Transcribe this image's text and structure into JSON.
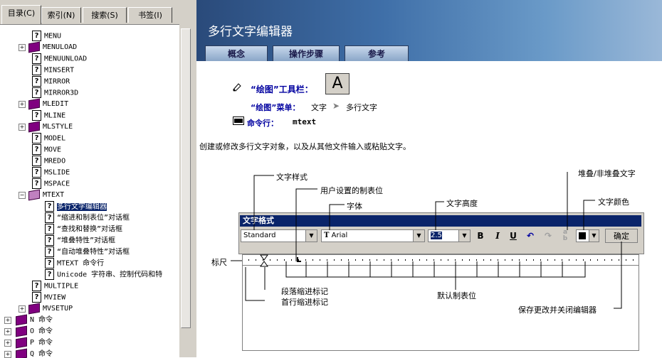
{
  "left_tabs": [
    "目录(C)",
    "索引(N)",
    "搜索(S)",
    "书签(I)"
  ],
  "tree_items": [
    {
      "label": "MENU",
      "type": "page"
    },
    {
      "label": "MENULOAD",
      "type": "book"
    },
    {
      "label": "MENUUNLOAD",
      "type": "page"
    },
    {
      "label": "MINSERT",
      "type": "page"
    },
    {
      "label": "MIRROR",
      "type": "page"
    },
    {
      "label": "MIRROR3D",
      "type": "page"
    },
    {
      "label": "MLEDIT",
      "type": "book"
    },
    {
      "label": "MLINE",
      "type": "page"
    },
    {
      "label": "MLSTYLE",
      "type": "book"
    },
    {
      "label": "MODEL",
      "type": "page"
    },
    {
      "label": "MOVE",
      "type": "page"
    },
    {
      "label": "MREDO",
      "type": "page"
    },
    {
      "label": "MSLIDE",
      "type": "page"
    },
    {
      "label": "MSPACE",
      "type": "page"
    },
    {
      "label": "MTEXT",
      "type": "openbook"
    },
    {
      "label": "多行文字编辑器",
      "type": "subpage",
      "selected": true
    },
    {
      "label": "“缩进和制表位”对话框",
      "type": "subpage"
    },
    {
      "label": "“查找和替换”对话框",
      "type": "subpage"
    },
    {
      "label": "“堆叠特性”对话框",
      "type": "subpage"
    },
    {
      "label": "“自动堆叠特性”对话框",
      "type": "subpage"
    },
    {
      "label": "MTEXT 命令行",
      "type": "subpage"
    },
    {
      "label": "Unicode 字符串、控制代码和特",
      "type": "subpage"
    },
    {
      "label": "MULTIPLE",
      "type": "page"
    },
    {
      "label": "MVIEW",
      "type": "page"
    },
    {
      "label": "MVSETUP",
      "type": "book"
    },
    {
      "label": "N 命令",
      "type": "rootbook"
    },
    {
      "label": "O 命令",
      "type": "rootbook"
    },
    {
      "label": "P 命令",
      "type": "rootbook"
    },
    {
      "label": "Q 命令",
      "type": "rootbook"
    }
  ],
  "page_title": "多行文字编辑器",
  "content_tabs": [
    "概念",
    "操作步骤",
    "参考"
  ],
  "toolbar_label": "“绘图”工具栏：",
  "toolbar_icon": "A",
  "menu_label": "“绘图”菜单：",
  "menu_path": [
    "文字",
    "多行文字"
  ],
  "cmd_label": "命令行：",
  "cmd_value": "mtext",
  "description": "创建或修改多行文字对象，以及从其他文件输入或粘贴文字。",
  "dialog": {
    "title": "文字格式",
    "style_value": "Standard",
    "font_value": "Arial",
    "height_value": "2.5",
    "bold": "B",
    "italic": "I",
    "underline": "U",
    "ok_label": "确定"
  },
  "callouts": {
    "text_style": "文字样式",
    "user_tab": "用户设置的制表位",
    "font": "字体",
    "text_height": "文字高度",
    "stack": "堆叠/非堆叠文字",
    "text_color": "文字颜色",
    "ruler": "标尺",
    "para_indent": "段落缩进标记",
    "first_indent": "首行缩进标记",
    "default_tab": "默认制表位",
    "save_close": "保存更改并关闭编辑器"
  },
  "colors": {
    "selection": "#0a246a",
    "dialog_title": "#0a246a",
    "tab_text": "#1a1a4a"
  }
}
